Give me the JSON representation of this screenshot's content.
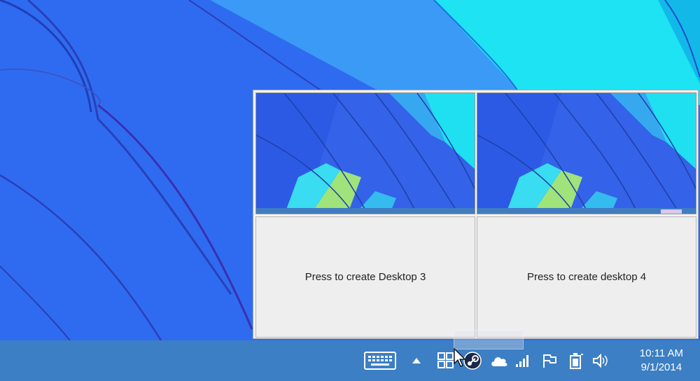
{
  "popup": {
    "buttons": [
      {
        "label": "Press to create Desktop 3"
      },
      {
        "label": "Press to create desktop 4"
      }
    ]
  },
  "tray": {
    "icons": [
      "keyboard-icon",
      "show-hidden-chevron-icon",
      "virtual-desktops-icon",
      "steam-icon",
      "onedrive-cloud-icon",
      "network-signal-icon",
      "action-center-flag-icon",
      "power-battery-icon",
      "volume-icon"
    ]
  },
  "clock": {
    "time": "10:11 AM",
    "date": "9/1/2014"
  },
  "colors": {
    "wallpaper_blue": "#2f6bf0",
    "wallpaper_cyan": "#20e0f0",
    "taskbar": "#3c7fc4"
  }
}
